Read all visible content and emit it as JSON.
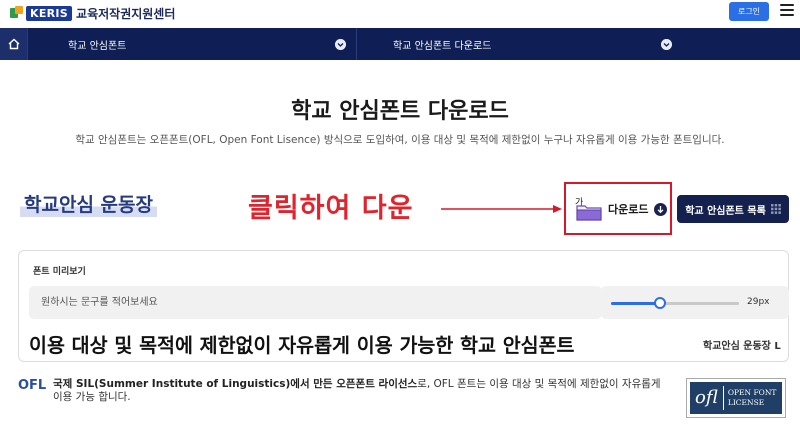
{
  "header": {
    "logo_badge": "KERIS",
    "logo_text": "교육저작권지원센터",
    "login_label": "로그인"
  },
  "nav": {
    "item1": "학교 안심폰트",
    "item2": "학교 안심폰트 다운로드"
  },
  "page": {
    "title": "학교 안심폰트 다운로드",
    "subtitle": "학교 안심폰트는 오픈폰트(OFL, Open Font Lisence) 방식으로 도입하여, 이용 대상 및 목적에 제한없이 누구나 자유롭게 이용 가능한 폰트입니다."
  },
  "font": {
    "name": "학교안심 운동장",
    "annotation": "클릭하여 다운",
    "download_label": "다운로드",
    "download_glyph": "가",
    "list_button": "학교 안심폰트 목록"
  },
  "preview": {
    "label": "폰트 미리보기",
    "placeholder": "원하시는 문구를 적어보세요",
    "size_value": "29px",
    "size_fraction": 0.29,
    "sample_text": "이용 대상 및 목적에 제한없이 자유롭게 이용 가능한 학교 안심폰트",
    "font_name": "학교안심 운동장 L"
  },
  "license": {
    "ofl_logo": "OFL",
    "desc_bold": "국제 SIL(Summer Institute of Linguistics)에서 만든 오픈폰트 라이선스",
    "desc_rest": "로, OFL 폰트는 이용 대상 및 목적에 제한없이 자유롭게 이용 가능 합니다.",
    "badge_ofl": "ofl",
    "badge_line1": "OPEN FONT",
    "badge_line2": "LICENSE"
  },
  "colors": {
    "navbar": "#0f1f56",
    "accent": "#2b6fe6",
    "annotation": "#e0242d"
  }
}
